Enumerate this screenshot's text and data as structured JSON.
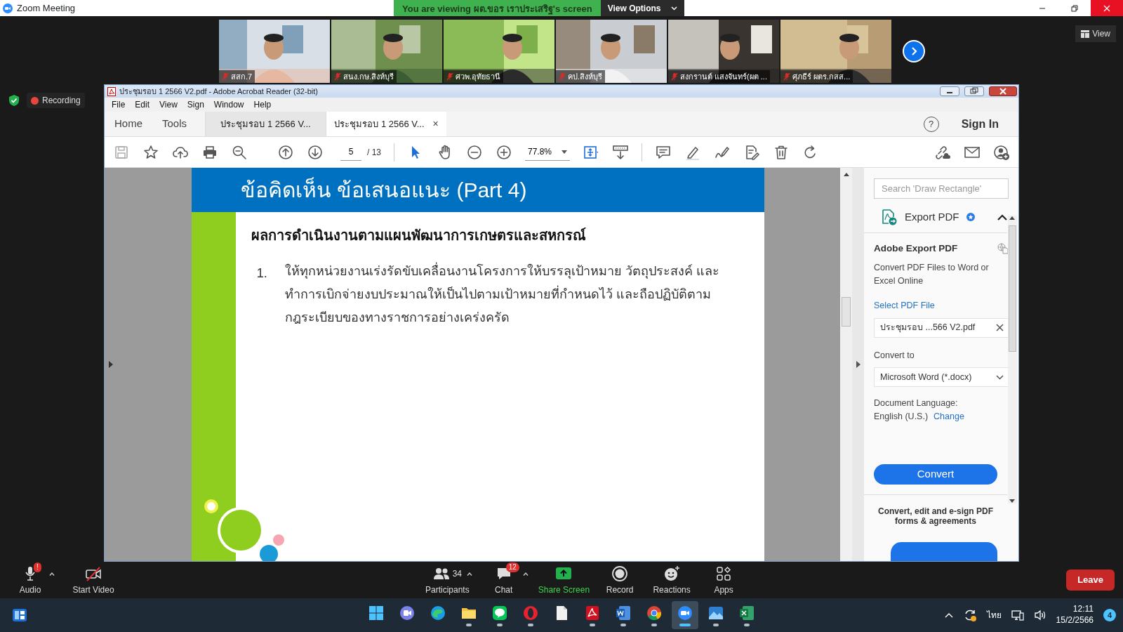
{
  "zoom_window": {
    "title": "Zoom Meeting",
    "sharing_banner": "You are viewing ผต.ขอร เราประเสริฐ's screen",
    "view_options": "View Options",
    "view_button": "View"
  },
  "video_tiles": [
    {
      "name": "สสก.7",
      "muted": true
    },
    {
      "name": "สนง.กษ.สิงห์บุรี",
      "muted": true
    },
    {
      "name": "ศวพ.อุทัยธานี",
      "muted": true
    },
    {
      "name": "คป.สิงห์บุรี",
      "muted": true
    },
    {
      "name": "สงกรานต์ แสงจันทร์(ผต ...",
      "muted": true
    },
    {
      "name": "ศุภธีร์ ผตร.กสส...",
      "muted": true
    }
  ],
  "recording": {
    "label": "Recording"
  },
  "acrobat": {
    "title": "ประชุมรอบ 1 2566 V2.pdf - Adobe Acrobat Reader (32-bit)",
    "menu": [
      "File",
      "Edit",
      "View",
      "Sign",
      "Window",
      "Help"
    ],
    "nav": [
      "Home",
      "Tools"
    ],
    "tabs": [
      {
        "label": "ประชุมรอบ 1 2566 V...",
        "selected": false
      },
      {
        "label": "ประชุมรอบ 1 2566 V...",
        "selected": true,
        "close": "×"
      }
    ],
    "help": "?",
    "sign_in": "Sign In",
    "page_number": "5",
    "page_total": "/ 13",
    "zoom_level": "77.8%",
    "document": {
      "heading": "ข้อคิดเห็น ข้อเสนอแนะ (Part 4)",
      "subheading": "ผลการดำเนินงานตามแผนพัฒนาการเกษตรและสหกรณ์",
      "items": [
        {
          "number": "1.",
          "text": "ให้ทุกหน่วยงานเร่งรัดขับเคลื่อนงานโครงการให้บรรลุเป้าหมาย วัตถุประสงค์ และทำการเบิกจ่ายงบประมาณให้เป็นไปตามเป้าหมายที่กำหนดไว้ และถือปฏิบัติตามกฎระเบียบของทางราชการอย่างเคร่งครัด"
        }
      ]
    },
    "panel": {
      "search_placeholder": "Search 'Draw Rectangle'",
      "tool": "Export PDF",
      "expanded": true,
      "title": "Adobe Export PDF",
      "description": "Convert PDF Files to Word or Excel Online",
      "select_label": "Select PDF File",
      "file": "ประชุมรอบ ...566 V2.pdf",
      "convert_to_label": "Convert to",
      "format": "Microsoft Word (*.docx)",
      "language_label": "Document Language:",
      "language": "English (U.S.)",
      "change_link": "Change",
      "convert_button": "Convert",
      "promo": "Convert, edit and e-sign PDF forms & agreements"
    }
  },
  "meeting_controls": [
    {
      "kind": "audio",
      "label": "Audio",
      "badge": "!"
    },
    {
      "kind": "video",
      "label": "Start Video"
    },
    {
      "kind": "participants",
      "label": "Participants",
      "count": "34"
    },
    {
      "kind": "chat",
      "label": "Chat",
      "badge": "12"
    },
    {
      "kind": "share",
      "label": "Share Screen"
    },
    {
      "kind": "record",
      "label": "Record"
    },
    {
      "kind": "reactions",
      "label": "Reactions"
    },
    {
      "kind": "apps",
      "label": "Apps"
    }
  ],
  "leave_button": "Leave",
  "taskbar": {
    "apps": [
      {
        "kind": "start"
      },
      {
        "kind": "teams",
        "running": false,
        "selected": false
      },
      {
        "kind": "edge",
        "running": false,
        "selected": false
      },
      {
        "kind": "explorer",
        "running": true,
        "selected": false
      },
      {
        "kind": "line",
        "running": true,
        "selected": false
      },
      {
        "kind": "opera",
        "running": true,
        "selected": false
      },
      {
        "kind": "file",
        "running": false,
        "selected": false
      },
      {
        "kind": "acrobat",
        "running": true,
        "selected": false
      },
      {
        "kind": "word",
        "running": true,
        "selected": false
      },
      {
        "kind": "chrome",
        "running": true,
        "selected": false
      },
      {
        "kind": "zoom",
        "running": true,
        "selected": true
      },
      {
        "kind": "photos",
        "running": true,
        "selected": false
      },
      {
        "kind": "excel",
        "running": true,
        "selected": false
      }
    ],
    "language": "ไทย",
    "time": "12:11",
    "date": "15/2/2566",
    "notifications": "4"
  }
}
